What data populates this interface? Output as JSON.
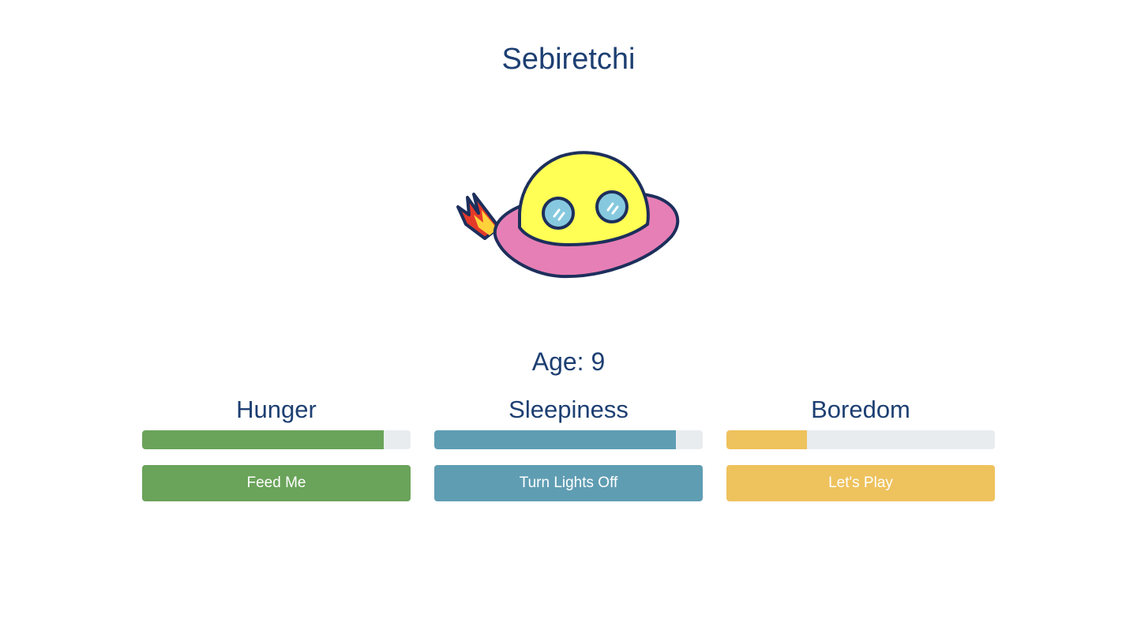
{
  "header": {
    "title": "Sebiretchi"
  },
  "pet": {
    "icon": "ufo-creature-icon",
    "colors": {
      "body": "#ffff55",
      "saucer": "#e67fb5",
      "flame_outer": "#e53a2a",
      "flame_inner": "#ffd23a",
      "eyes": "#86c9df",
      "outline": "#1d2f5c"
    }
  },
  "age": {
    "text": "Age: 9"
  },
  "stats": [
    {
      "label": "Hunger",
      "level_percent": 90,
      "color": "#6aa35a",
      "button_label": "Feed Me"
    },
    {
      "label": "Sleepiness",
      "level_percent": 90,
      "color": "#5f9db3",
      "button_label": "Turn Lights Off"
    },
    {
      "label": "Boredom",
      "level_percent": 30,
      "color": "#eec25d",
      "button_label": "Let's Play"
    }
  ],
  "theme": {
    "text_color": "#1d3f72",
    "track_color": "#e9ecef"
  }
}
